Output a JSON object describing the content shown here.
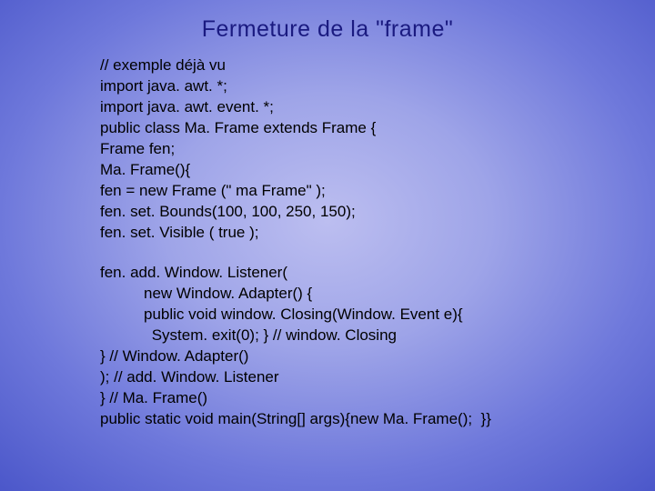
{
  "title": "Fermeture de la \"frame\"",
  "code": {
    "block1": [
      "// exemple déjà vu",
      "import java. awt. *;",
      "import java. awt. event. *;",
      "public class Ma. Frame extends Frame {",
      "Frame fen;",
      "Ma. Frame(){",
      "fen = new Frame (\" ma Frame\" );",
      "fen. set. Bounds(100, 100, 250, 150);",
      "fen. set. Visible ( true );"
    ],
    "block2": [
      {
        "text": "fen. add. Window. Listener(",
        "indent": ""
      },
      {
        "text": "new Window. Adapter() {",
        "indent": "indent1"
      },
      {
        "text": "public void window. Closing(Window. Event e){",
        "indent": "indent1"
      },
      {
        "text": " System. exit(0); } // window. Closing",
        "indent": "indent1b"
      },
      {
        "text": "} // Window. Adapter()",
        "indent": ""
      },
      {
        "text": "); // add. Window. Listener",
        "indent": ""
      },
      {
        "text": "} // Ma. Frame()",
        "indent": ""
      },
      {
        "text": "public static void main(String[] args){new Ma. Frame();  }}",
        "indent": ""
      }
    ]
  }
}
